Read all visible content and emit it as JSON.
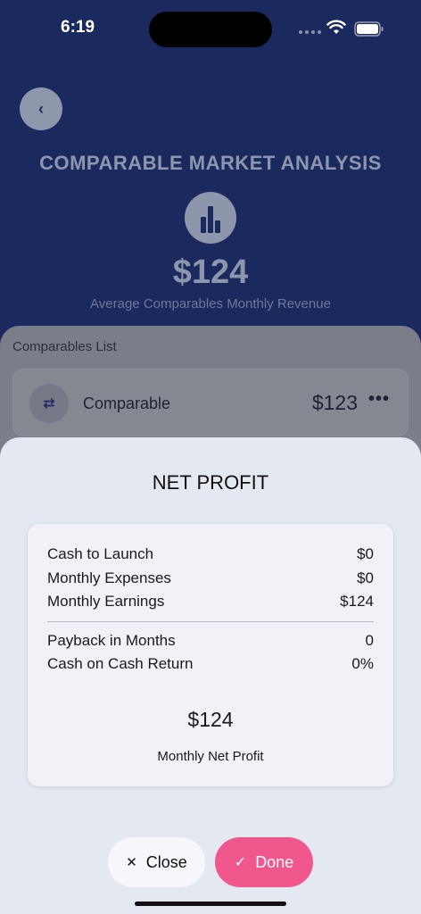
{
  "status_bar": {
    "time": "6:19"
  },
  "header": {
    "back_icon": "chevron-left-icon",
    "back_glyph": "‹",
    "title": "COMPARABLE MARKET ANALYSIS",
    "chart_icon": "bar-chart-icon",
    "value": "$124",
    "subtitle": "Average Comparables Monthly Revenue"
  },
  "comparables": {
    "title": "Comparables List",
    "items": [
      {
        "icon": "swap-arrows-icon",
        "glyph": "⇄",
        "name": "Comparable",
        "price": "$123",
        "more_glyph": "•••"
      }
    ]
  },
  "sheet": {
    "title": "NET PROFIT",
    "rows": [
      {
        "label": "Cash to Launch",
        "value": "$0"
      },
      {
        "label": "Monthly Expenses",
        "value": "$0"
      },
      {
        "label": "Monthly Earnings",
        "value": "$124"
      },
      {
        "label": "Payback in Months",
        "value": "0"
      },
      {
        "label": "Cash on Cash Return",
        "value": "0%"
      }
    ],
    "net_value": "$124",
    "net_label": "Monthly Net Profit",
    "close_label": "Close",
    "close_glyph": "✕",
    "done_label": "Done",
    "done_glyph": "✓"
  },
  "colors": {
    "header_bg": "#1a2a5e",
    "accent_pink": "#f0578c",
    "sheet_bg": "#e4e8f1"
  }
}
